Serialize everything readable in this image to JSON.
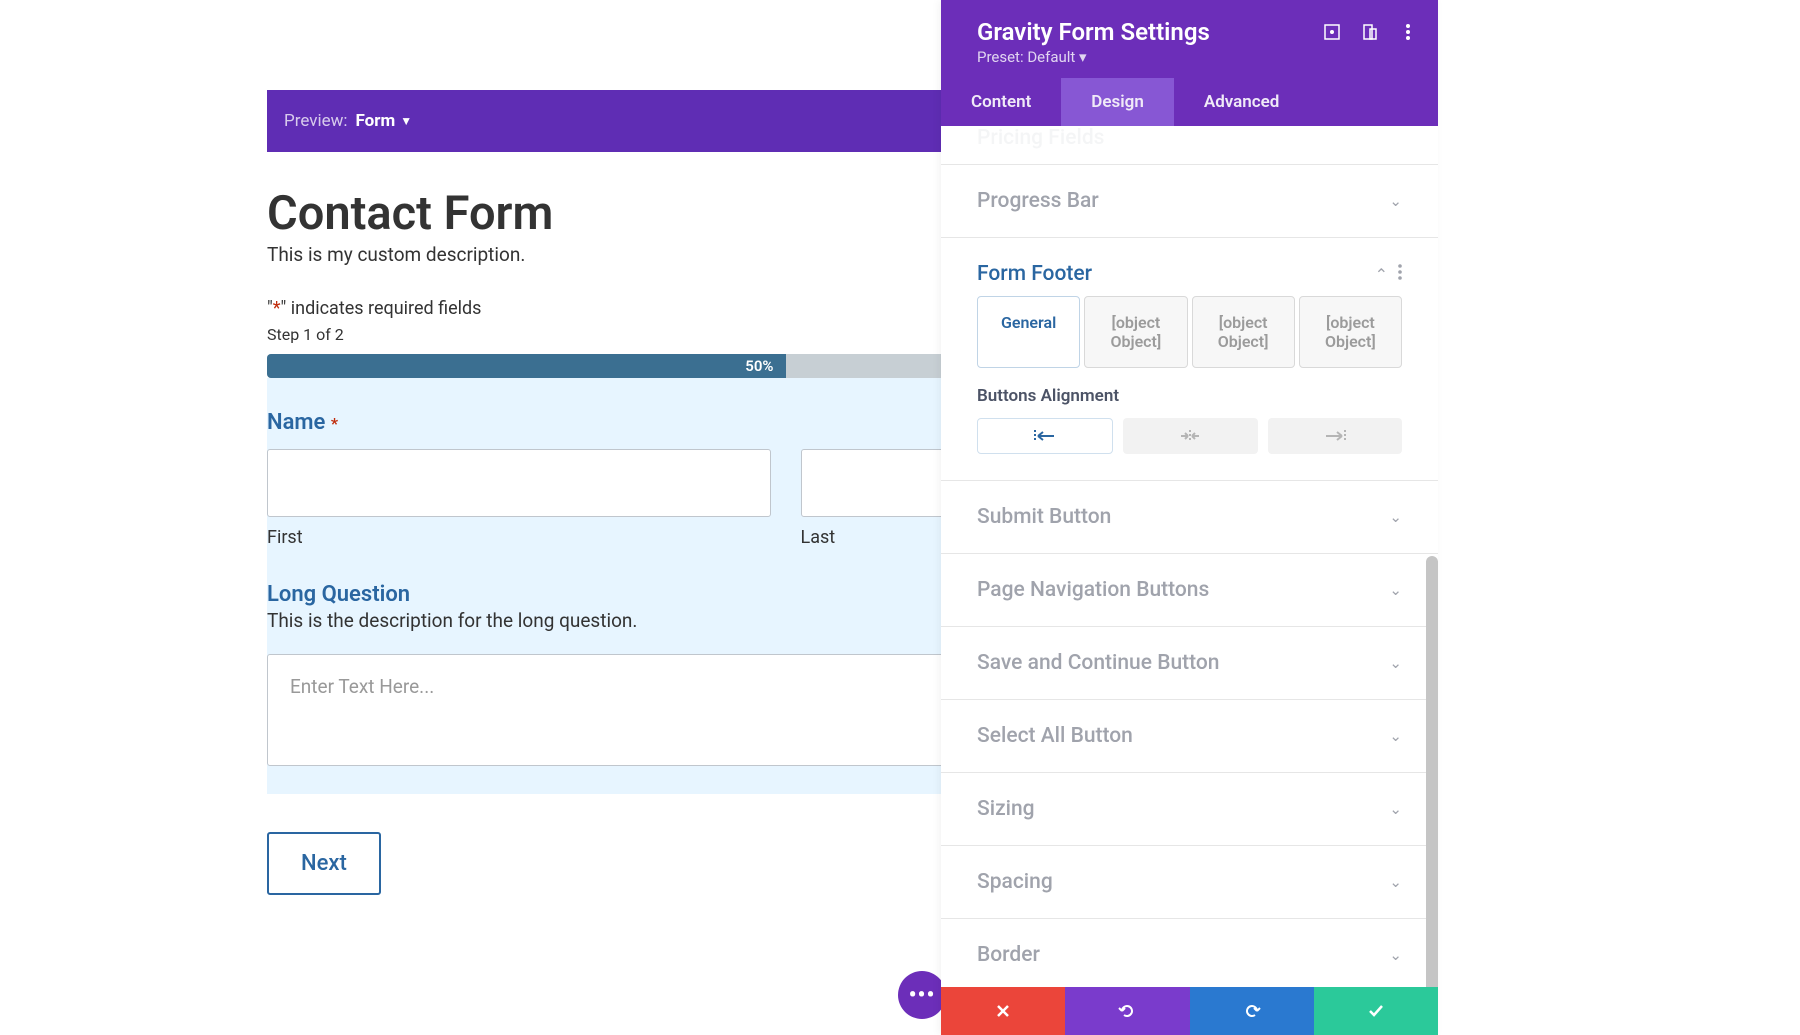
{
  "preview": {
    "label": "Preview:",
    "value": "Form"
  },
  "form": {
    "title": "Contact Form",
    "description": "This is my custom description.",
    "required_note_prefix": "\"",
    "required_note_asterisk": "*",
    "required_note_suffix": "\" indicates required fields",
    "step_label": "Step 1 of 2",
    "progress_percent": "50%",
    "name_field": {
      "label": "Name",
      "first_sub": "First",
      "last_sub": "Last"
    },
    "long_q": {
      "label": "Long Question",
      "description": "This is the description for the long question.",
      "placeholder": "Enter Text Here..."
    },
    "next_label": "Next"
  },
  "settings": {
    "title": "Gravity Form Settings",
    "preset": "Preset: Default ▾",
    "tabs": {
      "content": "Content",
      "design": "Design",
      "advanced": "Advanced"
    },
    "accordions": {
      "pricing_fields": "Pricing Fields",
      "progress_bar": "Progress Bar",
      "form_footer": "Form Footer",
      "submit_button": "Submit Button",
      "page_nav": "Page Navigation Buttons",
      "save_continue": "Save and Continue Button",
      "select_all": "Select All Button",
      "sizing": "Sizing",
      "spacing": "Spacing",
      "border": "Border"
    },
    "form_footer_section": {
      "sub_tabs": {
        "general": "General",
        "t2": "[object Object]",
        "t3": "[object Object]",
        "t4": "[object Object]"
      },
      "alignment_label": "Buttons Alignment"
    }
  }
}
